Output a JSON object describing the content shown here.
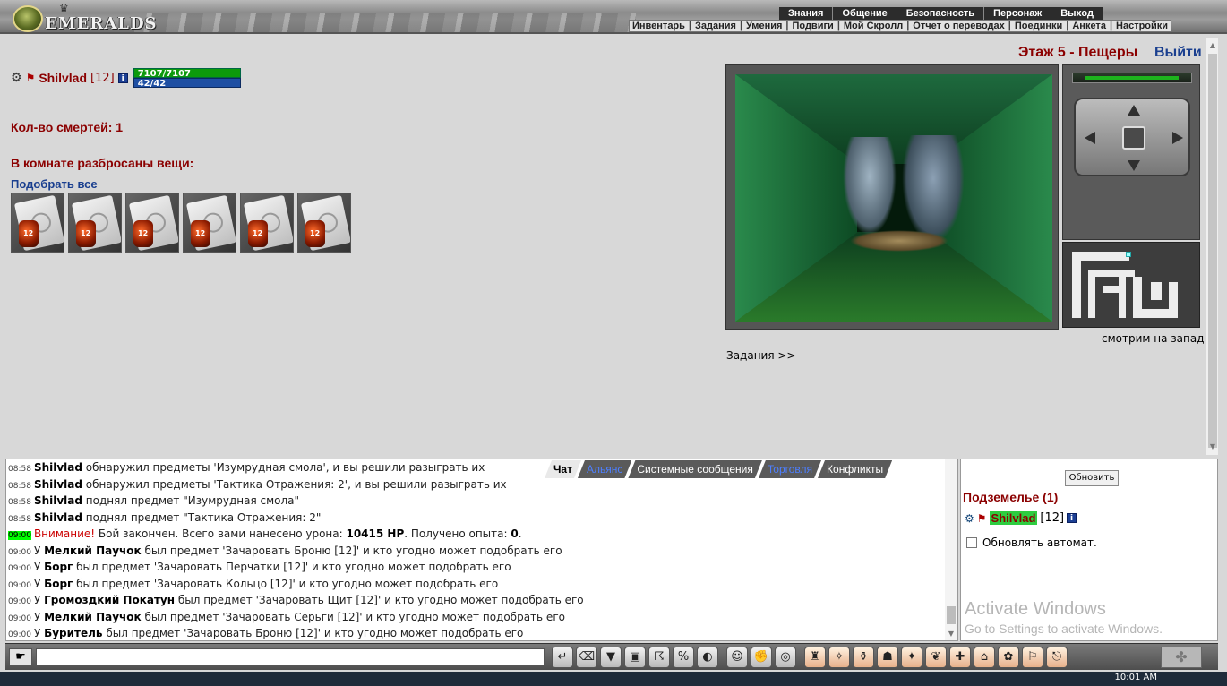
{
  "header": {
    "logo_text": "EMERALDS",
    "nav_top": [
      "Знания",
      "Общение",
      "Безопасность",
      "Персонаж",
      "Выход"
    ],
    "nav_bottom": [
      "Инвентарь",
      "Задания",
      "Умения",
      "Подвиги",
      "Мой Скролл",
      "Отчет о переводах",
      "Поединки",
      "Анкета",
      "Настройки"
    ]
  },
  "location": {
    "title": "Этаж 5 - Пещеры",
    "logout_label": "Выйти",
    "facing": "смотрим на запад",
    "quests_link": "Задания >>"
  },
  "player": {
    "name": "Shilvlad",
    "level": "[12]",
    "hp": "7107/7107",
    "mp": "42/42",
    "hp_fraction": 1.0,
    "mp_fraction": 1.0
  },
  "room": {
    "deaths": "Кол-во смертей: 1",
    "items_title": "В комнате разбросаны вещи:",
    "pickup_all": "Подобрать все",
    "items": [
      {
        "icon": "scroll-enchant-icon",
        "level": "12"
      },
      {
        "icon": "scroll-enchant-icon",
        "level": "12"
      },
      {
        "icon": "scroll-enchant-icon",
        "level": "12"
      },
      {
        "icon": "scroll-enchant-icon",
        "level": "12"
      },
      {
        "icon": "scroll-enchant-icon",
        "level": "12"
      },
      {
        "icon": "scroll-enchant-icon",
        "level": "12"
      }
    ]
  },
  "chat": {
    "tabs": [
      "Чат",
      "Альянс",
      "Системные сообщения",
      "Торговля",
      "Конфликты"
    ],
    "active_tab": "Чат",
    "lines": [
      {
        "time": "08:58",
        "parts": [
          {
            "b": "Shilvlad"
          },
          {
            "t": " обнаружил предметы 'Изумрудная смола', и вы решили разыграть их"
          }
        ]
      },
      {
        "time": "08:58",
        "parts": [
          {
            "b": "Shilvlad"
          },
          {
            "t": " обнаружил предметы 'Тактика Отражения: 2', и вы решили разыграть их"
          }
        ]
      },
      {
        "time": "08:58",
        "parts": [
          {
            "b": "Shilvlad"
          },
          {
            "t": " поднял предмет \"Изумрудная смола\""
          }
        ]
      },
      {
        "time": "08:58",
        "parts": [
          {
            "b": "Shilvlad"
          },
          {
            "t": " поднял предмет \"Тактика Отражения: 2\""
          }
        ]
      },
      {
        "time": "09:00",
        "highlight": true,
        "parts": [
          {
            "w": "Внимание!"
          },
          {
            "t": " Бой закончен. Всего вами нанесено урона: "
          },
          {
            "b": "10415 HP"
          },
          {
            "t": ". Получено опыта: "
          },
          {
            "b": "0"
          },
          {
            "t": "."
          }
        ]
      },
      {
        "time": "09:00",
        "parts": [
          {
            "t": "У "
          },
          {
            "b": "Мелкий Паучок"
          },
          {
            "t": " был предмет 'Зачаровать Броню [12]' и кто угодно может подобрать его"
          }
        ]
      },
      {
        "time": "09:00",
        "parts": [
          {
            "t": "У "
          },
          {
            "b": "Борг"
          },
          {
            "t": " был предмет 'Зачаровать Перчатки [12]' и кто угодно может подобрать его"
          }
        ]
      },
      {
        "time": "09:00",
        "parts": [
          {
            "t": "У "
          },
          {
            "b": "Борг"
          },
          {
            "t": " был предмет 'Зачаровать Кольцо [12]' и кто угодно может подобрать его"
          }
        ]
      },
      {
        "time": "09:00",
        "parts": [
          {
            "t": "У "
          },
          {
            "b": "Громоздкий Покатун"
          },
          {
            "t": " был предмет 'Зачаровать Щит [12]' и кто угодно может подобрать его"
          }
        ]
      },
      {
        "time": "09:00",
        "parts": [
          {
            "t": "У "
          },
          {
            "b": "Мелкий Паучок"
          },
          {
            "t": " был предмет 'Зачаровать Серьги [12]' и кто угодно может подобрать его"
          }
        ]
      },
      {
        "time": "09:00",
        "parts": [
          {
            "t": "У "
          },
          {
            "b": "Буритель"
          },
          {
            "t": " был предмет 'Зачаровать Броню [12]' и кто угодно может подобрать его"
          }
        ]
      }
    ]
  },
  "side": {
    "refresh_label": "Обновить",
    "dungeon_title": "Подземелье (1)",
    "player_name": "Shilvlad",
    "player_level": "[12]",
    "auto_refresh": "Обновлять автомат.",
    "watermark_line1": "Activate Windows",
    "watermark_line2": "Go to Settings to activate Windows."
  },
  "taskbar": {
    "time": "10:01 AM"
  },
  "colors": {
    "accent_red": "#8b0000",
    "link_blue": "#1a3f8f",
    "hp_green": "#0c9a0c",
    "mp_blue": "#1e4fa3"
  }
}
